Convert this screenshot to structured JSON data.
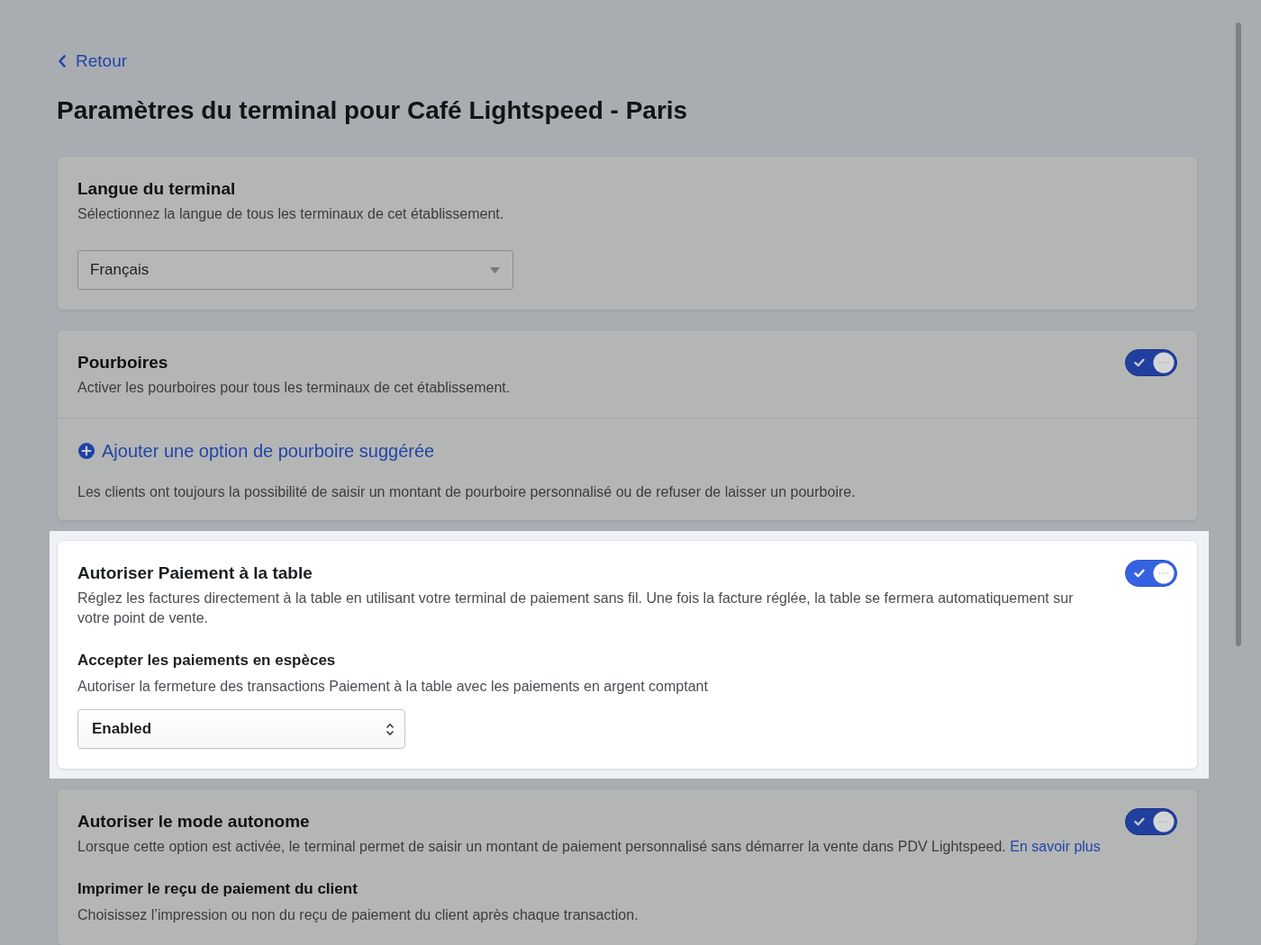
{
  "back_link": {
    "label": "Retour"
  },
  "page_title": "Paramètres du terminal pour Café Lightspeed - Paris",
  "sections": [
    {
      "title": "Langue du terminal",
      "description": "Sélectionnez la langue de tous les terminaux de cet établissement.",
      "spotlight": false,
      "select": {
        "kind": "dropdown",
        "value": "Français"
      }
    },
    {
      "title": "Pourboires",
      "description": "Activer les pourboires pour tous les terminaux de cet établissement.",
      "spotlight": false,
      "toggle": {
        "on": true
      },
      "footer": {
        "add_link": "Ajouter une option de pourboire suggérée",
        "note": "Les clients ont toujours la possibilité de saisir un montant de pourboire personnalisé ou de refuser de laisser un pourboire."
      }
    },
    {
      "title": "Autoriser Paiement à la table",
      "description": "Réglez les factures directement à la table en utilisant votre terminal de paiement sans fil. Une fois la facture réglée, la table se fermera automatiquement sur votre point de vente.",
      "spotlight": true,
      "toggle": {
        "on": true
      },
      "subsettings": [
        {
          "title": "Accepter les paiements en espèces",
          "description": "Autoriser la fermeture des transactions Paiement à la table avec les paiements en argent comptant",
          "select": {
            "kind": "stepper",
            "value": "Enabled"
          }
        }
      ]
    },
    {
      "title": "Autoriser le mode autonome",
      "description": "Lorsque cette option est activée, le terminal permet de saisir un montant de paiement personnalisé sans démarrer la vente dans PDV Lightspeed.",
      "description_link": "En savoir plus",
      "spotlight": false,
      "toggle": {
        "on": true
      },
      "subsettings": [
        {
          "title": "Imprimer le reçu de paiement du client",
          "description": "Choisissez l’impression ou non du reçu de paiement du client après chaque transaction."
        }
      ]
    }
  ]
}
